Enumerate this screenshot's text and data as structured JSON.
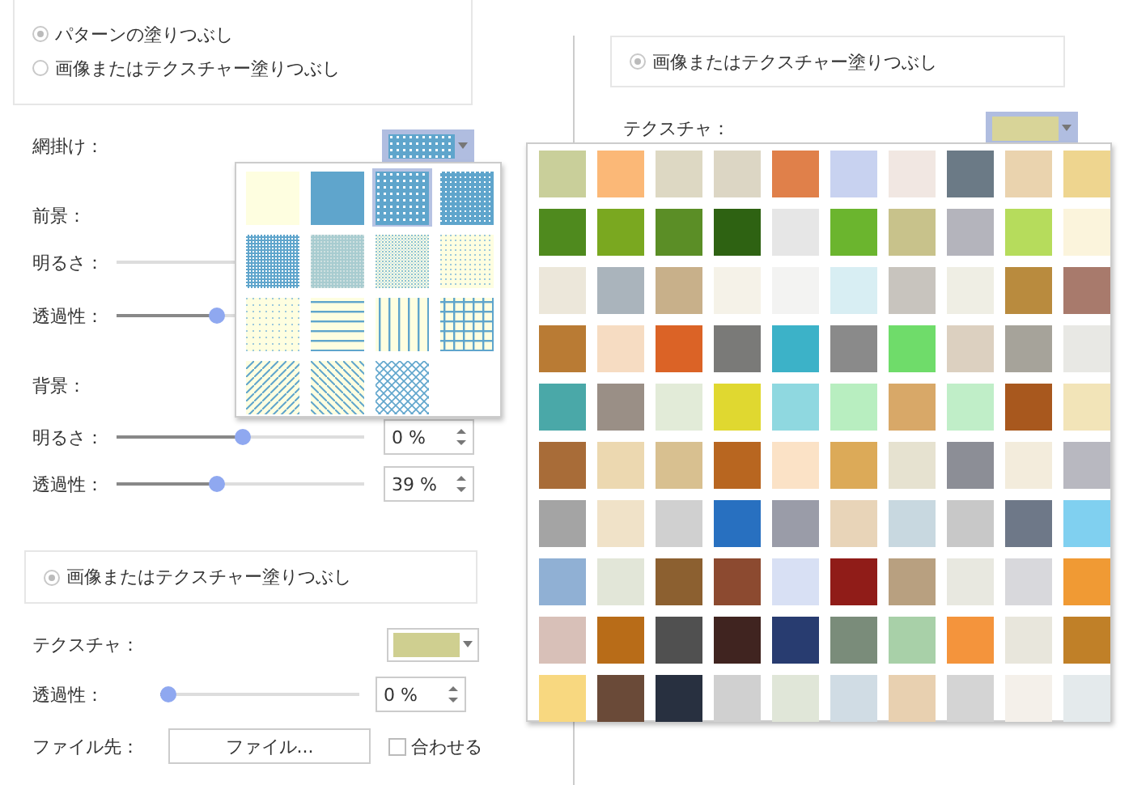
{
  "left_panel": {
    "fill_options": [
      {
        "label": "パターンの塗りつぶし",
        "selected": true
      },
      {
        "label": "画像またはテクスチャー塗りつぶし",
        "selected": false
      }
    ],
    "hatch": {
      "label": "網掛け：",
      "open": true
    },
    "foreground": {
      "heading": "前景：",
      "brightness": {
        "label": "明るさ："
      },
      "transparency": {
        "label": "透過性：",
        "level": 0.4
      }
    },
    "background": {
      "heading": "背景：",
      "brightness": {
        "label": "明るさ：",
        "level": 0.51,
        "reading": "0 %"
      },
      "transparency": {
        "label": "透過性：",
        "level": 0.4,
        "reading": "39 %"
      }
    },
    "texture_fill": {
      "label": "画像またはテクスチャー塗りつぶし",
      "selected": true
    },
    "texture": {
      "label": "テクスチャ：",
      "color": "#cfcf90",
      "open": false
    },
    "transparency": {
      "label": "透過性：",
      "level": 0,
      "reading": "0 %"
    },
    "file": {
      "label": "ファイル先：",
      "button": "ファイル...",
      "checkbox": {
        "label": "合わせる",
        "checked": false
      }
    }
  },
  "pattern_menu": {
    "items": [
      {
        "kind": "blank",
        "selected": false
      },
      {
        "kind": "solid",
        "selected": false
      },
      {
        "kind": "dots-large",
        "selected": true
      },
      {
        "kind": "checker",
        "selected": false
      },
      {
        "kind": "checker-dense",
        "selected": false
      },
      {
        "kind": "checker-fine",
        "selected": false
      },
      {
        "kind": "checker-light",
        "selected": false
      },
      {
        "kind": "dots-sparse",
        "selected": false
      },
      {
        "kind": "grid-dots",
        "selected": false
      },
      {
        "kind": "horizontal",
        "selected": false
      },
      {
        "kind": "vertical",
        "selected": false
      },
      {
        "kind": "grid",
        "selected": false
      },
      {
        "kind": "diagonal-up",
        "selected": false
      },
      {
        "kind": "diagonal-down",
        "selected": false
      },
      {
        "kind": "diagonal-cross",
        "selected": false
      }
    ]
  },
  "right_panel": {
    "texture_fill": {
      "label": "画像またはテクスチャー塗りつぶし",
      "selected": true
    },
    "texture": {
      "label": "テクスチャ：",
      "color": "#d8d498",
      "open": true
    }
  },
  "texture_menu": {
    "swatches": [
      {
        "color": "#c9cf9a"
      },
      {
        "color": "#fbb877"
      },
      {
        "color": "#ddd8c3"
      },
      {
        "color": "#dcd6c4"
      },
      {
        "color": "#e0804a"
      },
      {
        "color": "#c8d2f0"
      },
      {
        "color": "#f1e7e2"
      },
      {
        "color": "#6b7a86"
      },
      {
        "color": "#ead3ae"
      },
      {
        "color": "#eed58f"
      },
      {
        "color": "#4f8a1e"
      },
      {
        "color": "#7aa820"
      },
      {
        "color": "#5b8e26"
      },
      {
        "color": "#2e6212"
      },
      {
        "color": "#e6e6e6"
      },
      {
        "color": "#6bb52e"
      },
      {
        "color": "#c8c28b"
      },
      {
        "color": "#b4b4bc"
      },
      {
        "color": "#b6dc5c"
      },
      {
        "color": "#fbf4dc"
      },
      {
        "color": "#ece7da"
      },
      {
        "color": "#aab4bc"
      },
      {
        "color": "#c8b08a"
      },
      {
        "color": "#f5f2e8"
      },
      {
        "color": "#f3f3f2"
      },
      {
        "color": "#d8eef3"
      },
      {
        "color": "#c8c4be"
      },
      {
        "color": "#efeee4"
      },
      {
        "color": "#b98b3e"
      },
      {
        "color": "#a87a6c"
      },
      {
        "color": "#b97b34"
      },
      {
        "color": "#f6dcc2"
      },
      {
        "color": "#db6326"
      },
      {
        "color": "#7a7a78"
      },
      {
        "color": "#3cb2c8"
      },
      {
        "color": "#8a8a8a"
      },
      {
        "color": "#6fdc6a"
      },
      {
        "color": "#dcd0c0"
      },
      {
        "color": "#a6a39a"
      },
      {
        "color": "#e8e8e4"
      },
      {
        "color": "#4aa8a8"
      },
      {
        "color": "#9a8f86"
      },
      {
        "color": "#e2ebd8"
      },
      {
        "color": "#e0d830"
      },
      {
        "color": "#8fd8e0"
      },
      {
        "color": "#b8eec0"
      },
      {
        "color": "#d8a868"
      },
      {
        "color": "#c0eec8"
      },
      {
        "color": "#a8581e"
      },
      {
        "color": "#f2e4b8"
      },
      {
        "color": "#a86c38"
      },
      {
        "color": "#ecd8b0"
      },
      {
        "color": "#d8c090"
      },
      {
        "color": "#b86620"
      },
      {
        "color": "#fbe2c6"
      },
      {
        "color": "#dcaa58"
      },
      {
        "color": "#e6e2d0"
      },
      {
        "color": "#8c8e96"
      },
      {
        "color": "#f3ecdc"
      },
      {
        "color": "#b8b8c0"
      },
      {
        "color": "#a4a4a4"
      },
      {
        "color": "#f0e2c8"
      },
      {
        "color": "#d0d0d0"
      },
      {
        "color": "#2870c0"
      },
      {
        "color": "#9a9ca8"
      },
      {
        "color": "#e8d4b8"
      },
      {
        "color": "#c8d8e0"
      },
      {
        "color": "#c8c8c8"
      },
      {
        "color": "#6e7888"
      },
      {
        "color": "#80d0f0"
      },
      {
        "color": "#90b0d4"
      },
      {
        "color": "#e2e6d8"
      },
      {
        "color": "#8c6030"
      },
      {
        "color": "#8c4a30"
      },
      {
        "color": "#d8e0f4"
      },
      {
        "color": "#901c18"
      },
      {
        "color": "#b8a080"
      },
      {
        "color": "#e8e8e0"
      },
      {
        "color": "#d8d8dc"
      },
      {
        "color": "#f09a34"
      },
      {
        "color": "#d8c0b8"
      },
      {
        "color": "#b86c18"
      },
      {
        "color": "#505050"
      },
      {
        "color": "#402420"
      },
      {
        "color": "#283c70"
      },
      {
        "color": "#7a8c7a"
      },
      {
        "color": "#a8d0a8"
      },
      {
        "color": "#f4943c"
      },
      {
        "color": "#e8e6dc"
      },
      {
        "color": "#c08028"
      },
      {
        "color": "#f8d880"
      },
      {
        "color": "#6a4a38"
      },
      {
        "color": "#283040"
      },
      {
        "color": "#d0d0d0"
      },
      {
        "color": "#e0e6d8"
      },
      {
        "color": "#d0dce4"
      },
      {
        "color": "#e8d0b0"
      },
      {
        "color": "#d4d4d4"
      },
      {
        "color": "#f4f0ea"
      },
      {
        "color": "#e4eaec"
      }
    ]
  }
}
